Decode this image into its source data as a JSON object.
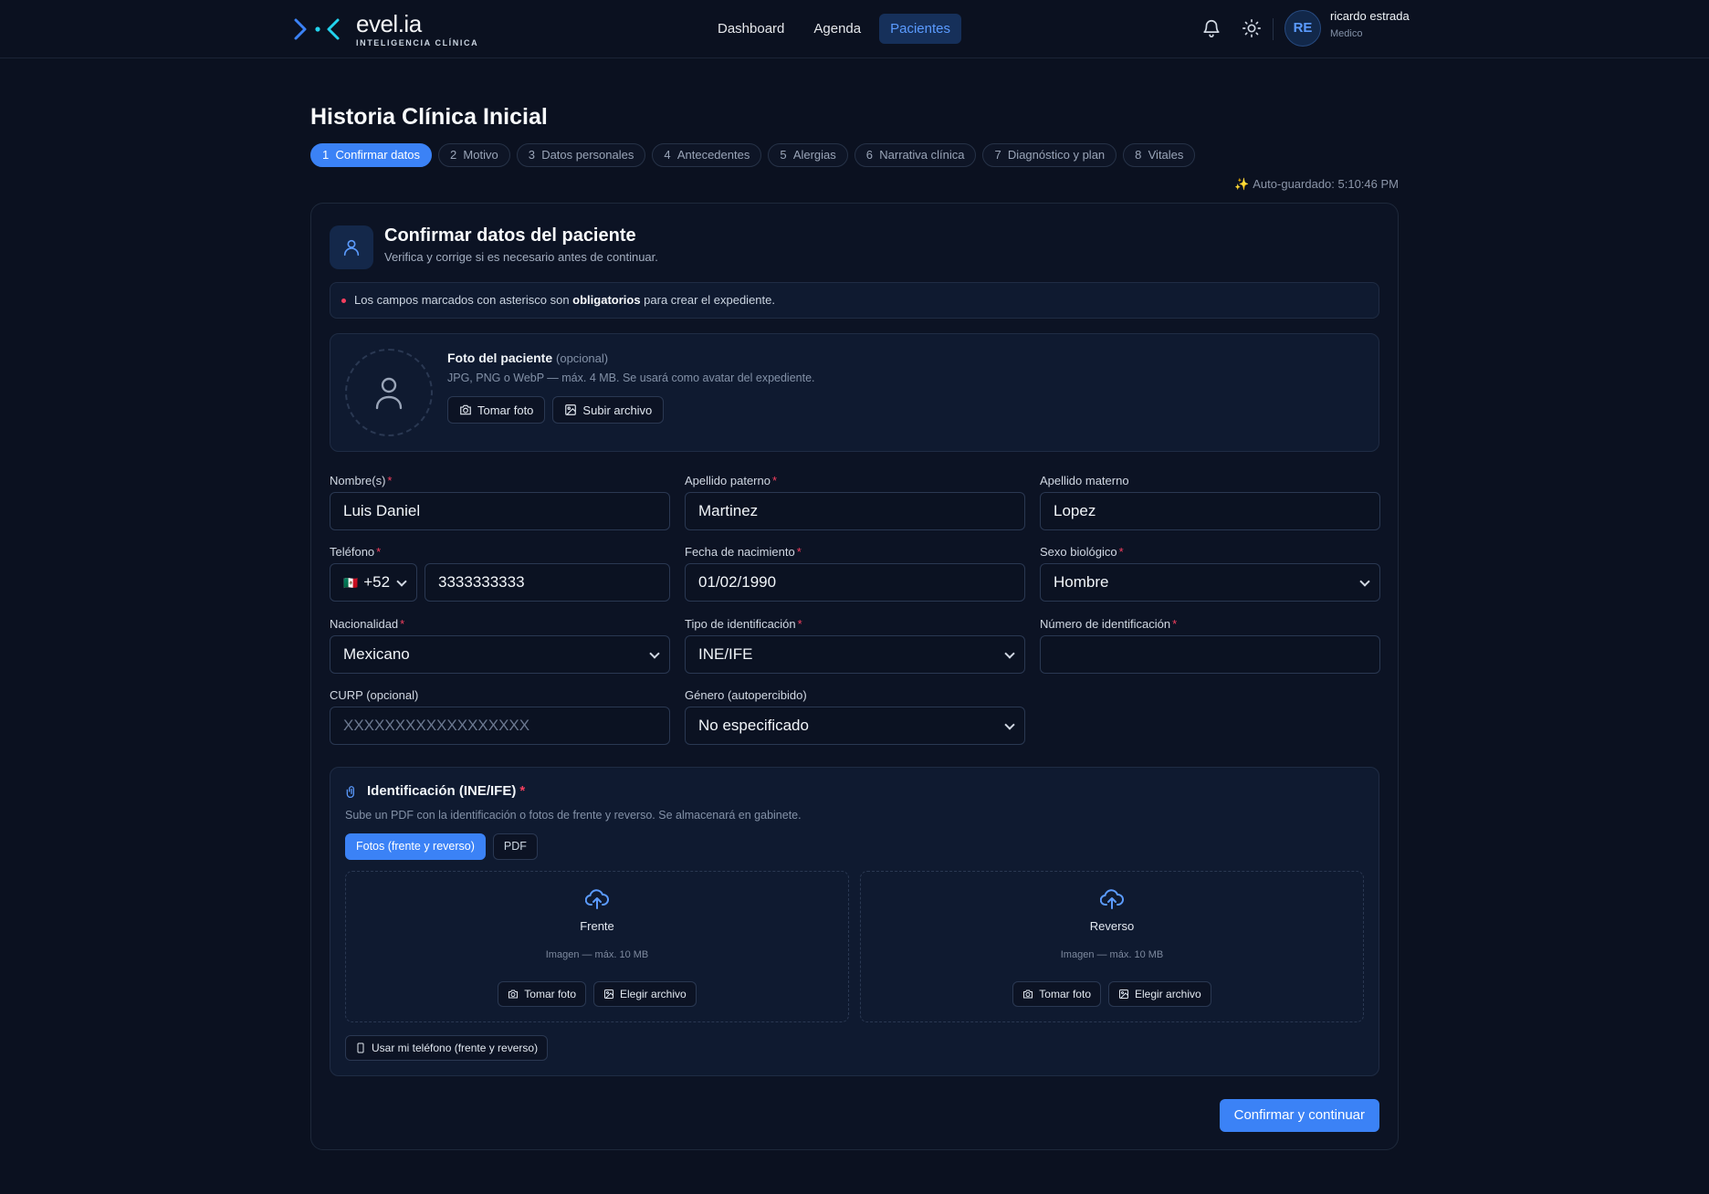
{
  "brand": {
    "name": "evel.ia",
    "tagline": "INTELIGENCIA CLÍNICA"
  },
  "nav": {
    "items": [
      "Dashboard",
      "Agenda",
      "Pacientes"
    ],
    "active": "Pacientes"
  },
  "user": {
    "initials": "RE",
    "name": "ricardo estrada",
    "role": "Medico"
  },
  "page": {
    "title": "Historia Clínica Inicial",
    "steps": [
      {
        "num": "1",
        "label": "Confirmar datos",
        "active": true
      },
      {
        "num": "2",
        "label": "Motivo"
      },
      {
        "num": "3",
        "label": "Datos personales"
      },
      {
        "num": "4",
        "label": "Antecedentes"
      },
      {
        "num": "5",
        "label": "Alergias"
      },
      {
        "num": "6",
        "label": "Narrativa clínica"
      },
      {
        "num": "7",
        "label": "Diagnóstico y plan"
      },
      {
        "num": "8",
        "label": "Vitales"
      }
    ],
    "autosave": "Auto-guardado: 5:10:46 PM"
  },
  "card": {
    "title": "Confirmar datos del paciente",
    "subtitle": "Verifica y corrige si es necesario antes de continuar.",
    "notice_pre": "Los campos marcados con asterisco son ",
    "notice_bold": "obligatorios",
    "notice_post": " para crear el expediente."
  },
  "photo": {
    "title": "Foto del paciente",
    "optional": "(opcional)",
    "hint": "JPG, PNG o WebP — máx. 4 MB. Se usará como avatar del expediente.",
    "take": "Tomar foto",
    "upload": "Subir archivo"
  },
  "form": {
    "nombre": {
      "label": "Nombre(s)",
      "value": "Luis Daniel"
    },
    "paterno": {
      "label": "Apellido paterno",
      "value": "Martinez"
    },
    "materno": {
      "label": "Apellido materno",
      "value": "Lopez"
    },
    "telefono": {
      "label": "Teléfono",
      "flag": "🇲🇽",
      "code": "+52",
      "value": "3333333333"
    },
    "nacimiento": {
      "label": "Fecha de nacimiento",
      "value": "01/02/1990"
    },
    "sexo": {
      "label": "Sexo biológico",
      "value": "Hombre"
    },
    "nacionalidad": {
      "label": "Nacionalidad",
      "value": "Mexicano"
    },
    "tipo_id": {
      "label": "Tipo de identificación",
      "value": "INE/IFE"
    },
    "numero_id": {
      "label": "Número de identificación",
      "value": ""
    },
    "curp": {
      "label": "CURP (opcional)",
      "placeholder": "XXXXXXXXXXXXXXXXXX"
    },
    "genero": {
      "label": "Género (autopercibido)",
      "value": "No especificado"
    }
  },
  "identificacion": {
    "title": "Identificación (INE/IFE)",
    "subtitle": "Sube un PDF con la identificación o fotos de frente y reverso. Se almacenará en gabinete.",
    "tabs": [
      "Fotos (frente y reverso)",
      "PDF"
    ],
    "front": {
      "label": "Frente",
      "hint": "Imagen — máx. 10 MB"
    },
    "back": {
      "label": "Reverso",
      "hint": "Imagen — máx. 10 MB"
    },
    "take": "Tomar foto",
    "choose": "Elegir archivo",
    "phone": "Usar mi teléfono (frente y reverso)"
  },
  "actions": {
    "confirm": "Confirmar y continuar"
  },
  "colors": {
    "accent": "#3b82f6",
    "background": "#0b1120",
    "required": "#f43f5e"
  }
}
